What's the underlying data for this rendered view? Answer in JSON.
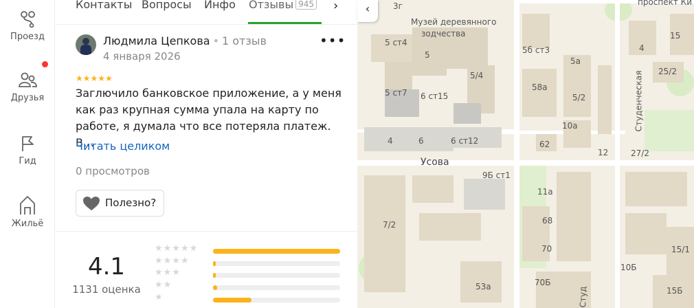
{
  "sidebar": {
    "items": [
      {
        "label": "Проезд",
        "icon": "route-icon"
      },
      {
        "label": "Друзья",
        "icon": "friends-icon"
      },
      {
        "label": "Гид",
        "icon": "flag-icon"
      },
      {
        "label": "Жильё",
        "icon": "home-icon"
      }
    ]
  },
  "tabs": {
    "items": [
      "Контакты",
      "Вопросы",
      "Инфо",
      "Отзывы"
    ],
    "reviews_count": "945",
    "active": "Отзывы"
  },
  "review": {
    "author": "Людмила Цепкова",
    "author_reviews": "1 отзыв",
    "date": "4 января 2026",
    "rating": 5,
    "stars": "★★★★★",
    "text": "Заглючило банковское приложение, а у меня как раз крупная сумма упала на карту по работе, я думала что все потеряла платеж. В…",
    "read_more": "Читать целиком",
    "views": "0 просмотров",
    "useful_label": "Полезно?",
    "more_label": "•••"
  },
  "summary": {
    "rating": "4.1",
    "count": "1131 оценка",
    "distribution": [
      {
        "stars": "★★★★★",
        "fraction": 1.0
      },
      {
        "stars": "★★★★",
        "fraction": 0.02
      },
      {
        "stars": "★★★",
        "fraction": 0.02
      },
      {
        "stars": "★★",
        "fraction": 0.03
      },
      {
        "stars": "★",
        "fraction": 0.3
      }
    ]
  },
  "map": {
    "labels": [
      "3г",
      "Музей деревянного",
      "зодчества",
      "проспект Ки",
      "15",
      "4",
      "5 ст4",
      "5",
      "5б ст3",
      "5а",
      "25/2",
      "Студенческая",
      "5/4",
      "58а",
      "5 ст7",
      "6 ст15",
      "5/2",
      "10а",
      "4",
      "6",
      "6 ст12",
      "62",
      "12",
      "27/2",
      "Усова",
      "9Б ст1",
      "11а",
      "7/2",
      "68",
      "70",
      "15/1",
      "70Б",
      "10Б",
      "53а",
      "15Б",
      "Студ"
    ]
  },
  "colors": {
    "accent_green": "#2aa22a",
    "link_blue": "#1565c0",
    "star_yellow": "#fcb21b",
    "notification_red": "#ff3333"
  }
}
